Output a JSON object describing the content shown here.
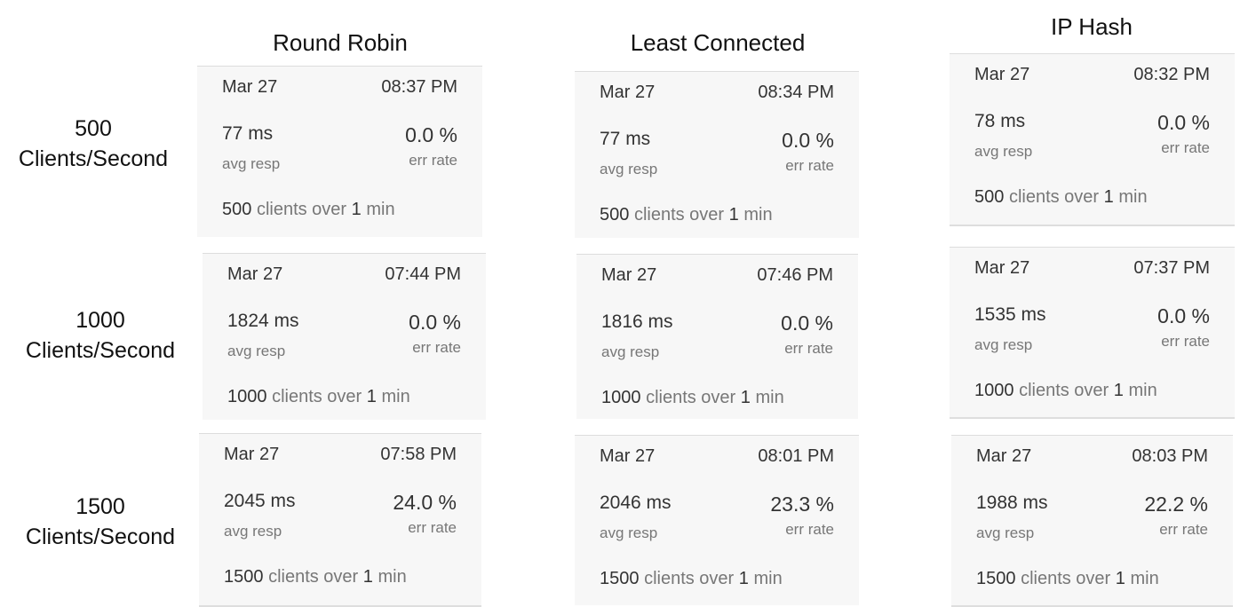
{
  "columns": [
    "Round Robin",
    "Least Connected",
    "IP Hash"
  ],
  "rows": [
    {
      "line1": "500",
      "line2": "Clients/Second"
    },
    {
      "line1": "1000",
      "line2": "Clients/Second"
    },
    {
      "line1": "1500",
      "line2": "Clients/Second"
    }
  ],
  "labels": {
    "avg_resp": "avg resp",
    "err_rate": "err rate",
    "clients_over": "clients over",
    "min": "min"
  },
  "cards": [
    [
      {
        "date": "Mar 27",
        "time": "08:37 PM",
        "resp": "77 ms",
        "err": "0.0 %",
        "clients": "500",
        "duration": "1"
      },
      {
        "date": "Mar 27",
        "time": "08:34 PM",
        "resp": "77 ms",
        "err": "0.0 %",
        "clients": "500",
        "duration": "1"
      },
      {
        "date": "Mar 27",
        "time": "08:32 PM",
        "resp": "78 ms",
        "err": "0.0 %",
        "clients": "500",
        "duration": "1"
      }
    ],
    [
      {
        "date": "Mar 27",
        "time": "07:44 PM",
        "resp": "1824 ms",
        "err": "0.0 %",
        "clients": "1000",
        "duration": "1"
      },
      {
        "date": "Mar 27",
        "time": "07:46 PM",
        "resp": "1816 ms",
        "err": "0.0 %",
        "clients": "1000",
        "duration": "1"
      },
      {
        "date": "Mar 27",
        "time": "07:37 PM",
        "resp": "1535 ms",
        "err": "0.0 %",
        "clients": "1000",
        "duration": "1"
      }
    ],
    [
      {
        "date": "Mar 27",
        "time": "07:58 PM",
        "resp": "2045 ms",
        "err": "24.0 %",
        "clients": "1500",
        "duration": "1"
      },
      {
        "date": "Mar 27",
        "time": "08:01 PM",
        "resp": "2046 ms",
        "err": "23.3 %",
        "clients": "1500",
        "duration": "1"
      },
      {
        "date": "Mar 27",
        "time": "08:03 PM",
        "resp": "1988 ms",
        "err": "22.2 %",
        "clients": "1500",
        "duration": "1"
      }
    ]
  ]
}
